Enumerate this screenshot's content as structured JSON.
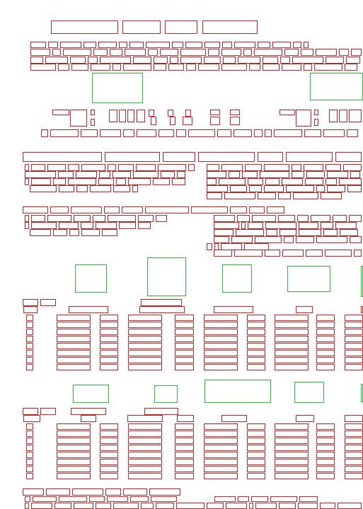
{
  "page": {
    "title": "",
    "text_box_color": "#c22a2a",
    "figure_box_color": "#2fbf3b"
  },
  "sections": [
    {
      "label": "",
      "kind": "title-block"
    },
    {
      "label": "",
      "kind": "intro-figures"
    },
    {
      "label": "",
      "kind": "two-column-text"
    },
    {
      "label": "",
      "kind": "figure-row-1"
    },
    {
      "label": "",
      "kind": "figure-row-2"
    },
    {
      "label": "",
      "kind": "footer-text"
    }
  ]
}
